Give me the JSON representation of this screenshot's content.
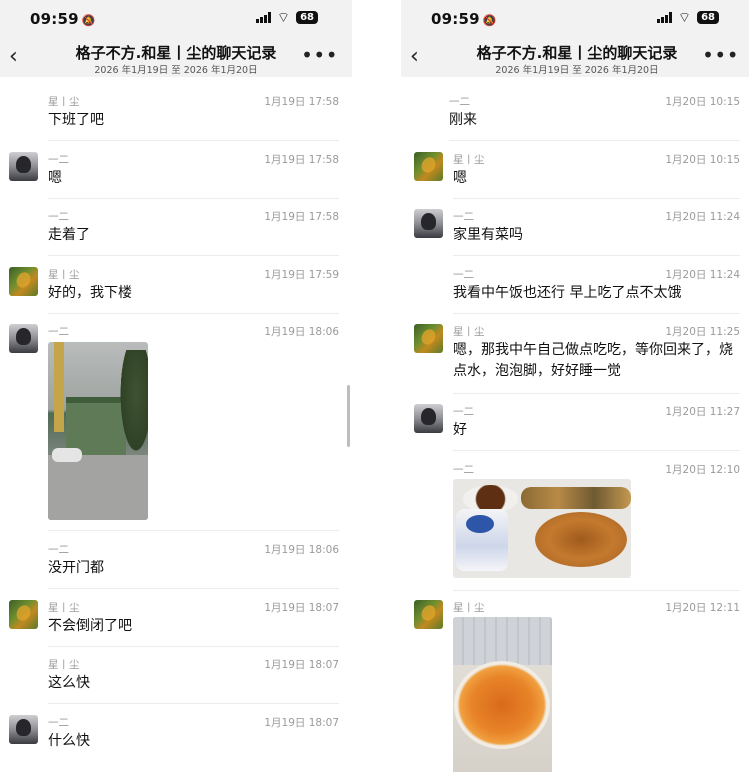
{
  "left": {
    "status": {
      "time": "09:59",
      "battery": "68"
    },
    "header": {
      "title": "格子不方.和星丨尘的聊天记录",
      "range": "2026 年1月19日 至 2026 年1月20日"
    },
    "messages": [
      {
        "sender": "星丨尘",
        "time": "1月19日 17:58",
        "text": "下班了吧",
        "avatar": "none"
      },
      {
        "sender": "一二",
        "time": "1月19日 17:58",
        "text": "嗯",
        "avatar": "yier"
      },
      {
        "sender": "一二",
        "time": "1月19日 17:58",
        "text": "走着了",
        "avatar": "none"
      },
      {
        "sender": "星丨尘",
        "time": "1月19日 17:59",
        "text": "好的，我下楼",
        "avatar": "star"
      },
      {
        "sender": "一二",
        "time": "1月19日 18:06",
        "text": "",
        "avatar": "yier",
        "image": "building-photo"
      },
      {
        "sender": "一二",
        "time": "1月19日 18:06",
        "text": "没开门都",
        "avatar": "none"
      },
      {
        "sender": "星丨尘",
        "time": "1月19日 18:07",
        "text": "不会倒闭了吧",
        "avatar": "star"
      },
      {
        "sender": "星丨尘",
        "time": "1月19日 18:07",
        "text": "这么快",
        "avatar": "none"
      },
      {
        "sender": "一二",
        "time": "1月19日 18:07",
        "text": "什么快",
        "avatar": "yier"
      }
    ]
  },
  "right": {
    "status": {
      "time": "09:59",
      "battery": "68"
    },
    "header": {
      "title": "格子不方.和星丨尘的聊天记录",
      "range": "2026 年1月19日 至 2026 年1月20日"
    },
    "messages": [
      {
        "sender": "一二",
        "time": "1月20日 10:15",
        "text": "刚来",
        "avatar": "none"
      },
      {
        "sender": "星丨尘",
        "time": "1月20日 10:15",
        "text": "嗯",
        "avatar": "star"
      },
      {
        "sender": "一二",
        "time": "1月20日 11:24",
        "text": "家里有菜吗",
        "avatar": "yier"
      },
      {
        "sender": "一二",
        "time": "1月20日 11:24",
        "text": "我看中午饭也还行 早上吃了点不太饿",
        "avatar": "none"
      },
      {
        "sender": "星丨尘",
        "time": "1月20日 11:25",
        "text": "嗯，那我中午自己做点吃吃，等你回来了，烧点水，泡泡脚，好好睡一觉",
        "avatar": "star"
      },
      {
        "sender": "一二",
        "time": "1月20日 11:27",
        "text": "好",
        "avatar": "yier"
      },
      {
        "sender": "一二",
        "time": "1月20日 12:10",
        "text": "",
        "avatar": "none",
        "image": "food-tray-photo"
      },
      {
        "sender": "星丨尘",
        "time": "1月20日 12:11",
        "text": "",
        "avatar": "star",
        "image": "eggs-bowl-photo"
      }
    ]
  },
  "icons": {
    "back": "chevron-left-icon",
    "more": "more-dots-icon",
    "mute": "bell-slash-icon",
    "wifi": "wifi-icon",
    "signal": "signal-icon"
  }
}
